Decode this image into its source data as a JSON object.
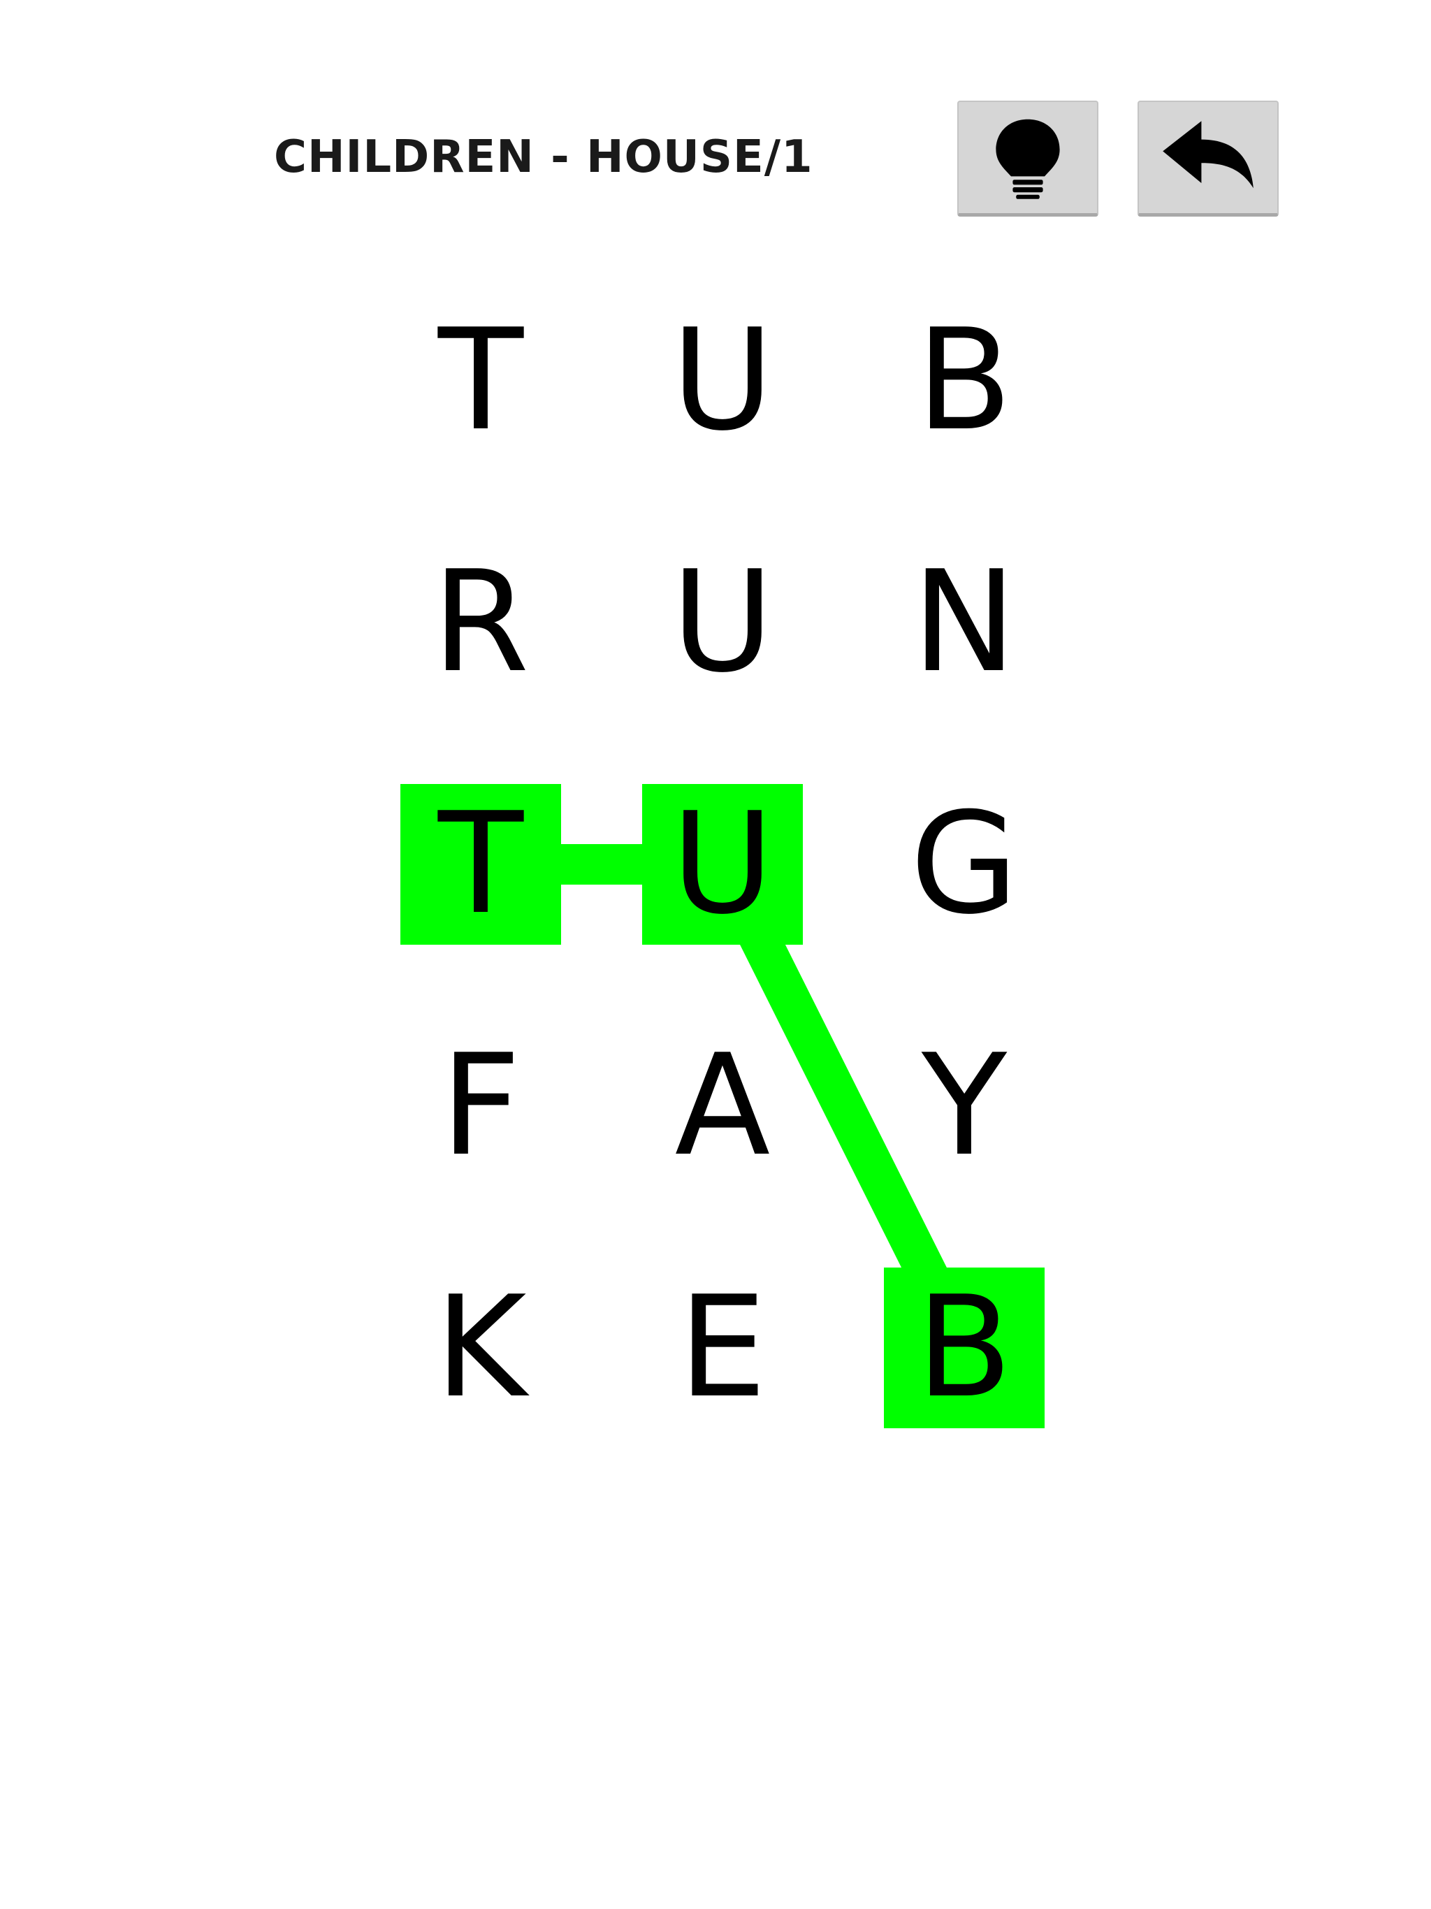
{
  "header": {
    "level_title": "CHILDREN - HOUSE/1",
    "hint_icon": "lightbulb-icon",
    "back_icon": "undo-arrow-icon"
  },
  "grid": {
    "rows": 5,
    "cols": 3,
    "letters": [
      [
        "T",
        "U",
        "B"
      ],
      [
        "R",
        "U",
        "N"
      ],
      [
        "T",
        "U",
        "G"
      ],
      [
        "F",
        "A",
        "Y"
      ],
      [
        "K",
        "E",
        "B"
      ]
    ],
    "selected_path": [
      [
        2,
        0
      ],
      [
        2,
        1
      ],
      [
        4,
        2
      ]
    ],
    "highlight_color": "#00ff00"
  }
}
